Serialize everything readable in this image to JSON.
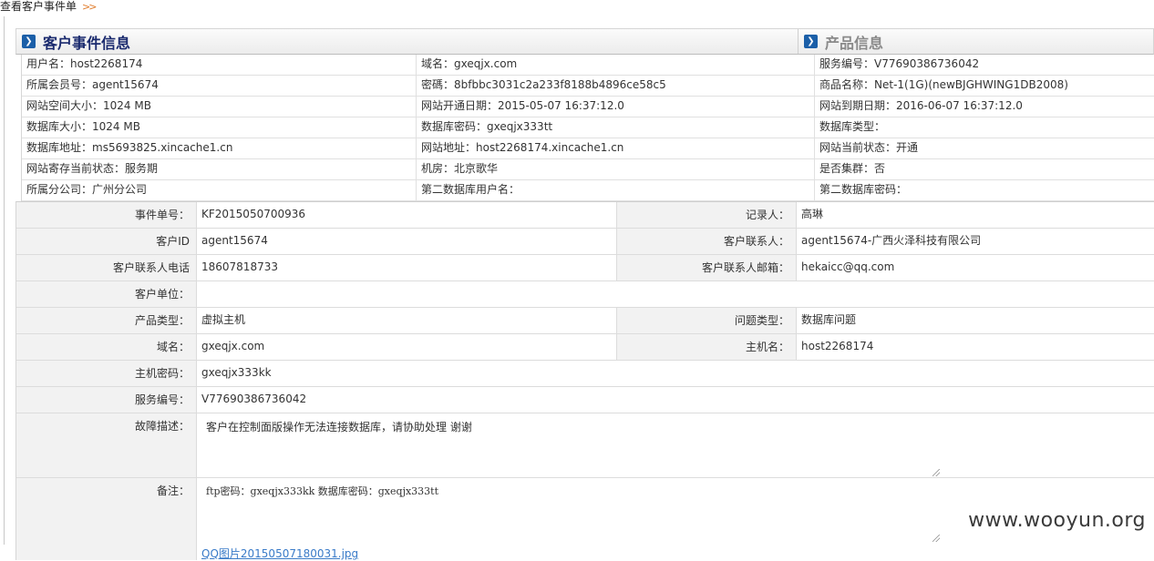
{
  "page": {
    "title": "查看客户事件单",
    "chevron": ">>"
  },
  "sections": {
    "customer_event": "客户事件信息",
    "product": "产品信息"
  },
  "info_rows": [
    [
      "用户名：host2268174",
      "域名：gxeqjx.com",
      "服务编号：V77690386736042"
    ],
    [
      "所属会员号：agent15674",
      "密碼：8bfbbc3031c2a233f8188b4896ce58c5",
      "商品名称：Net-1(1G)(newBJGHWING1DB2008)"
    ],
    [
      "网站空间大小：1024 MB",
      "网站开通日期：2015-05-07 16:37:12.0",
      "网站到期日期：2016-06-07 16:37:12.0"
    ],
    [
      "数据库大小：1024 MB",
      "数据库密码：gxeqjx333tt",
      "数据库类型："
    ],
    [
      "数据库地址：ms5693825.xincache1.cn",
      "网站地址：host2268174.xincache1.cn",
      "网站当前状态：开通"
    ],
    [
      "网站寄存当前状态：服务期",
      "机房：北京歌华",
      "是否集群：否"
    ],
    [
      "所属分公司：广州分公司",
      "第二数据库用户名：",
      "第二数据库密码："
    ]
  ],
  "form": {
    "event_no": {
      "label": "事件单号：",
      "value": "KF2015050700936"
    },
    "recorder": {
      "label": "记录人：",
      "value": "高琳"
    },
    "customer_id": {
      "label": "客户ID",
      "value": "agent15674"
    },
    "contact": {
      "label": "客户联系人：",
      "value": "agent15674-广西火泽科技有限公司"
    },
    "contact_phone": {
      "label": "客户联系人电话",
      "value": "18607818733"
    },
    "contact_email": {
      "label": "客户联系人邮箱：",
      "value": "hekaicc@qq.com"
    },
    "unit": {
      "label": "客户单位：",
      "value": ""
    },
    "product_type": {
      "label": "产品类型：",
      "value": "虚拟主机"
    },
    "issue_type": {
      "label": "问题类型：",
      "value": "数据库问题"
    },
    "domain": {
      "label": "域名：",
      "value": "gxeqjx.com"
    },
    "hostname": {
      "label": "主机名：",
      "value": "host2268174"
    },
    "host_password": {
      "label": "主机密码：",
      "value": "gxeqjx333kk"
    },
    "service_no": {
      "label": "服务编号：",
      "value": "V77690386736042"
    },
    "fault": {
      "label": "故障描述：",
      "value": "客户在控制面版操作无法连接数据库，请协助处理  谢谢"
    },
    "remark": {
      "label": "备注：",
      "value": "ftp密码：gxeqjx333kk    数据库密码：gxeqjx333tt",
      "attachment": "QQ图片20150507180031.jpg"
    }
  },
  "watermark": "www.wooyun.org"
}
